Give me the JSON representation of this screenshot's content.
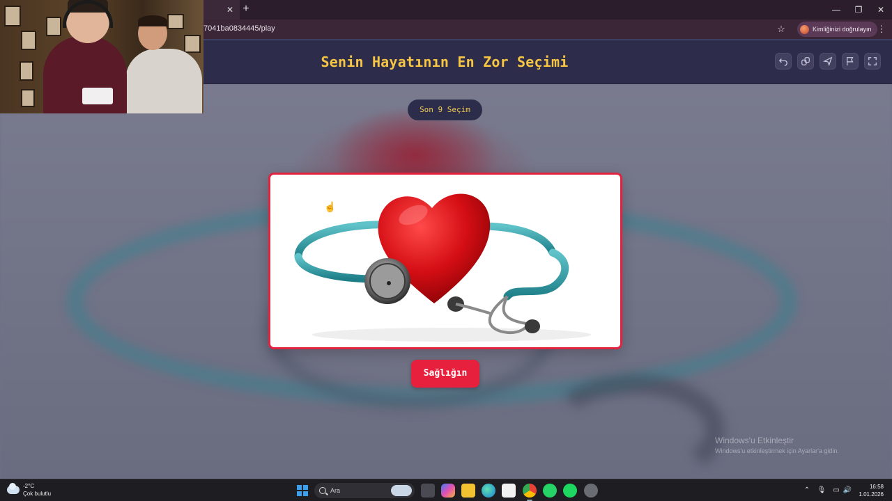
{
  "browser": {
    "tab_close_glyph": "✕",
    "new_tab_glyph": "+",
    "url": "7041ba0834445/play",
    "profile_label": "Kimliğinizi doğrulayın",
    "star_icon": "star-icon",
    "menu_icon": "kebab-icon",
    "window_controls": [
      "minimize",
      "restore",
      "close"
    ],
    "window_glyphs": {
      "minimize": "—",
      "restore": "❐",
      "close": "✕"
    }
  },
  "page": {
    "title": "Senin Hayatının En Zor Seçimi",
    "progress_pill": "Son 9 Seçim",
    "answer_button": "Sağlığın",
    "toolbar_icons": [
      "undo-icon",
      "share-icon",
      "send-icon",
      "flag-icon",
      "fullscreen-icon"
    ],
    "colors": {
      "header_bg": "#2d2d4b",
      "title": "#f6c544",
      "accent_red": "#e6203d",
      "card_border": "#e2233f"
    }
  },
  "windows_activation": {
    "title": "Windows'u Etkinleştir",
    "subtitle": "Windows'u etkinleştirmek için Ayarlar'a gidin."
  },
  "taskbar": {
    "weather_temp": "-2°C",
    "weather_desc": "Çok bulutlu",
    "search_placeholder": "Ara",
    "time": "16:58",
    "date": "1.01.2026",
    "apps": [
      "task-view",
      "copilot",
      "file-explorer",
      "edge",
      "store",
      "chrome",
      "whatsapp",
      "spotify",
      "other-app"
    ]
  }
}
